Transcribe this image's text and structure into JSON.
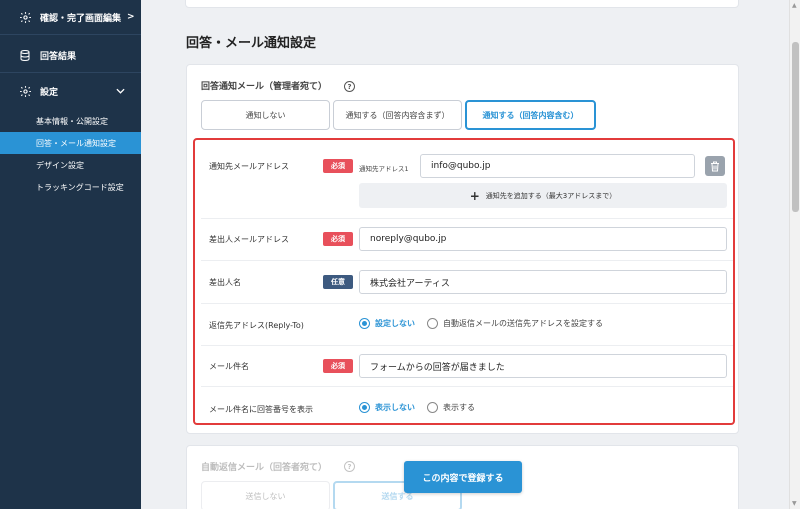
{
  "sidebar": {
    "items": [
      {
        "label": "確認・完了画面編集",
        "icon": "gear-icon",
        "chevron": ">"
      },
      {
        "label": "回答結果",
        "icon": "database-icon"
      },
      {
        "label": "設定",
        "icon": "gear-icon",
        "chevron": "⌄"
      }
    ],
    "sub_items": [
      {
        "label": "基本情報・公開設定"
      },
      {
        "label": "回答・メール通知設定",
        "active": true
      },
      {
        "label": "デザイン設定"
      },
      {
        "label": "トラッキングコード設定"
      }
    ]
  },
  "main": {
    "page_title": "回答・メール通知設定",
    "admin_notice": {
      "section_label": "回答通知メール（管理者宛て）",
      "help": "?",
      "options": [
        "通知しない",
        "通知する（回答内容含まず）",
        "通知する（回答内容含む）"
      ],
      "selected_option": "通知する（回答内容含む）"
    },
    "fields": {
      "to_address": {
        "label": "通知先メールアドレス",
        "badge": "必須",
        "sub_label": "通知先アドレス1",
        "value": "info@qubo.jp",
        "add_button": "通知先を追加する（最大3アドレスまで）"
      },
      "from_address": {
        "label": "差出人メールアドレス",
        "badge": "必須",
        "value": "noreply@qubo.jp"
      },
      "from_name": {
        "label": "差出人名",
        "badge": "任意",
        "value": "株式会社アーティス"
      },
      "reply_to": {
        "label": "返信先アドレス(Reply-To)",
        "options": [
          "設定しない",
          "自動返信メールの送信先アドレスを設定する"
        ],
        "selected": "設定しない"
      },
      "subject": {
        "label": "メール件名",
        "badge": "必須",
        "value": "フォームからの回答が届きました"
      },
      "show_number": {
        "label": "メール件名に回答番号を表示",
        "options": [
          "表示しない",
          "表示する"
        ],
        "selected": "表示しない"
      }
    },
    "auto_reply": {
      "section_label": "自動返信メール（回答者宛て）",
      "help": "?",
      "options": [
        "送信しない",
        "送信する"
      ]
    },
    "submit_label": "この内容で登録する"
  },
  "colors": {
    "sidebar_bg": "#1e3349",
    "accent": "#2a93d5",
    "required_badge": "#e8505b",
    "optional_badge": "#3d5a80",
    "highlight_border": "#e23b3b"
  }
}
